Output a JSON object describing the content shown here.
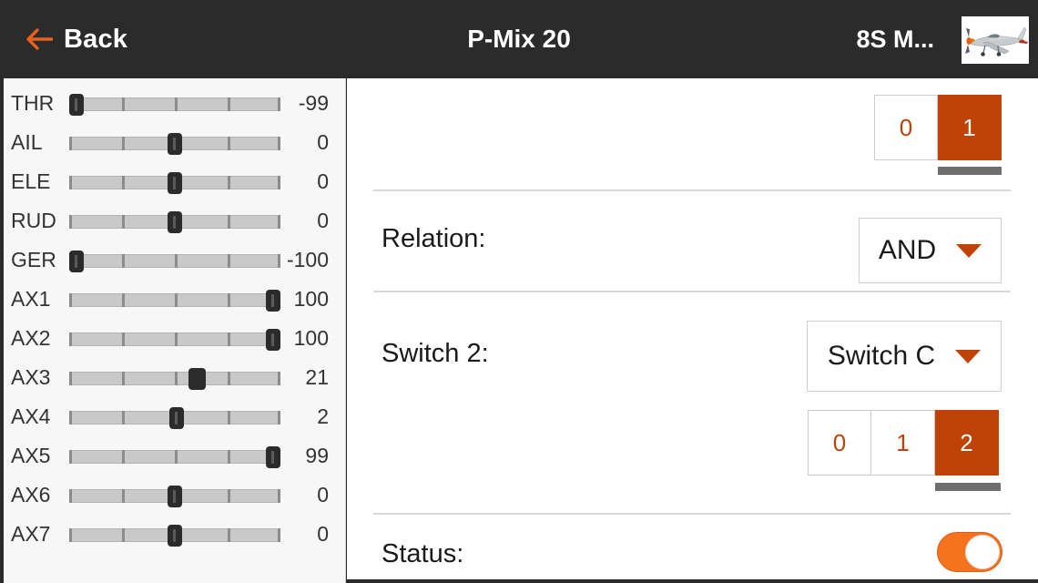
{
  "header": {
    "back_label": "Back",
    "back_icon": "arrow-left-icon",
    "title": "P-Mix 20",
    "model_name": "8S M...",
    "model_thumb_icon": "airplane-thumbnail",
    "accent": "#e8601c",
    "background": "#2b2b2b"
  },
  "sidebar": {
    "channels": [
      {
        "label": "THR",
        "value": "-99",
        "pct": 0.5,
        "thumb": "slim"
      },
      {
        "label": "AIL",
        "value": "0",
        "pct": 50.0,
        "thumb": "slim"
      },
      {
        "label": "ELE",
        "value": "0",
        "pct": 50.0,
        "thumb": "slim"
      },
      {
        "label": "RUD",
        "value": "0",
        "pct": 50.0,
        "thumb": "slim"
      },
      {
        "label": "GER",
        "value": "-100",
        "pct": 0.0,
        "thumb": "slim"
      },
      {
        "label": "AX1",
        "value": "100",
        "pct": 100.0,
        "thumb": "slim"
      },
      {
        "label": "AX2",
        "value": "100",
        "pct": 100.0,
        "thumb": "slim"
      },
      {
        "label": "AX3",
        "value": "21",
        "pct": 60.5,
        "thumb": "solid"
      },
      {
        "label": "AX4",
        "value": "2",
        "pct": 51.0,
        "thumb": "slim"
      },
      {
        "label": "AX5",
        "value": "99",
        "pct": 99.5,
        "thumb": "slim"
      },
      {
        "label": "AX6",
        "value": "0",
        "pct": 50.0,
        "thumb": "slim"
      },
      {
        "label": "AX7",
        "value": "0",
        "pct": 50.0,
        "thumb": "slim"
      }
    ],
    "tick_positions": [
      0,
      25,
      50,
      75,
      100
    ],
    "range": [
      -100,
      100
    ]
  },
  "panel": {
    "switch1_positions": {
      "options": [
        "0",
        "1"
      ],
      "selected": "1",
      "selected_index": 1
    },
    "relation": {
      "label": "Relation:",
      "value": "AND",
      "caret_icon": "chevron-down-icon"
    },
    "switch2": {
      "label": "Switch 2:",
      "value": "Switch C",
      "caret_icon": "chevron-down-icon"
    },
    "switch2_positions": {
      "options": [
        "0",
        "1",
        "2"
      ],
      "selected": "2",
      "selected_index": 2
    },
    "status": {
      "label": "Status:",
      "enabled": true,
      "toggle_color": "#f5721e"
    },
    "accent_selected": "#bf4306",
    "accent_text": "#bf4306"
  }
}
